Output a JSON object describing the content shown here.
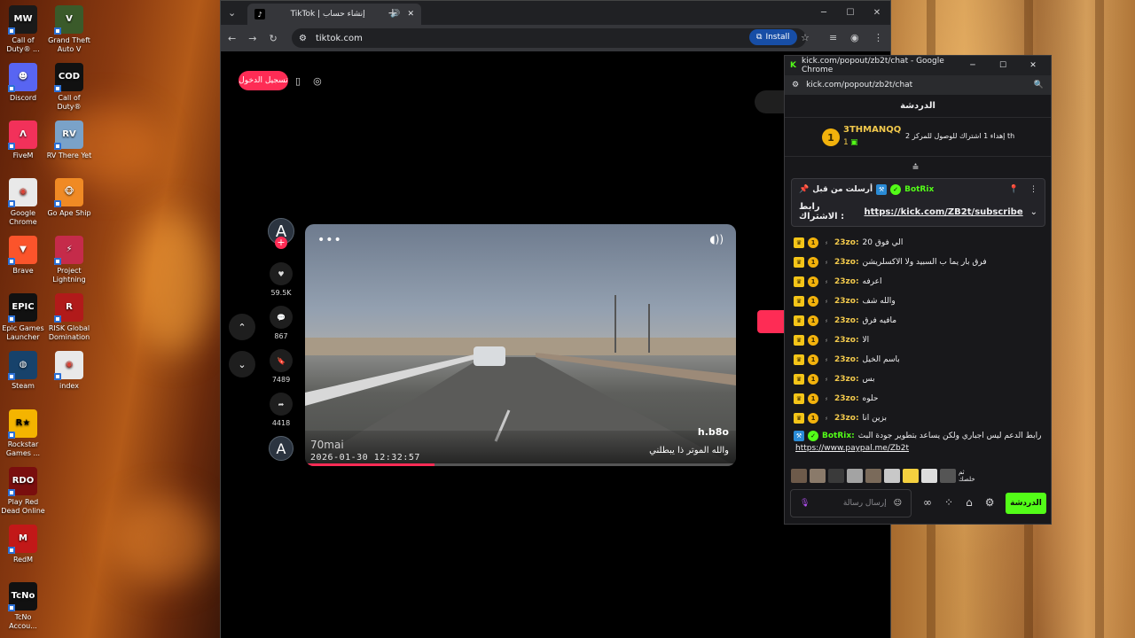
{
  "desktop": {
    "icons": [
      {
        "label": "Call of Duty® ...",
        "glyph": "MW",
        "color": "#1a1a1a",
        "fg": "#ffffff"
      },
      {
        "label": "Grand Theft Auto V",
        "glyph": "V",
        "color": "#3a5a2a",
        "fg": "#ffffff"
      },
      {
        "label": "Discord",
        "glyph": "☻",
        "color": "#5865f2",
        "fg": "#ffffff"
      },
      {
        "label": "Call of Duty®",
        "glyph": "COD",
        "color": "#111111",
        "fg": "#ffffff"
      },
      {
        "label": "FiveM",
        "glyph": "Λ",
        "color": "#f2315a",
        "fg": "#ffffff"
      },
      {
        "label": "RV There Yet",
        "glyph": "RV",
        "color": "#7aa2c8",
        "fg": "#ffffff"
      },
      {
        "label": "Google Chrome",
        "glyph": "◉",
        "color": "#e9e9e9",
        "fg": "#db4437"
      },
      {
        "label": "Go Ape Ship",
        "glyph": "🐵",
        "color": "#f08a24",
        "fg": "#ffffff"
      },
      {
        "label": "Brave",
        "glyph": "▼",
        "color": "#fb542b",
        "fg": "#ffffff"
      },
      {
        "label": "Project Lightning",
        "glyph": "⚡",
        "color": "#c52b4a",
        "fg": "#ffffff"
      },
      {
        "label": "Epic Games Launcher",
        "glyph": "EPIC",
        "color": "#111111",
        "fg": "#ffffff"
      },
      {
        "label": "RISK Global Domination",
        "glyph": "R",
        "color": "#b11a1a",
        "fg": "#ffffff"
      },
      {
        "label": "Steam",
        "glyph": "◍",
        "color": "#17426b",
        "fg": "#ffffff"
      },
      {
        "label": "index",
        "glyph": "◉",
        "color": "#e9e9e9",
        "fg": "#db4437"
      },
      {
        "label": "Rockstar Games ...",
        "glyph": "R★",
        "color": "#f4b400",
        "fg": "#000000"
      },
      {
        "label": "Play Red Dead Online",
        "glyph": "RDO",
        "color": "#7a0e0e",
        "fg": "#ffffff"
      },
      {
        "label": "RedM",
        "glyph": "M",
        "color": "#c21818",
        "fg": "#ffffff"
      },
      {
        "label": "TcNo Accou...",
        "glyph": "TcNo",
        "color": "#111111",
        "fg": "#ffffff"
      }
    ]
  },
  "browser": {
    "tab_title": "TikTok | إنشاء حساب",
    "tab_favicon": "♪",
    "url": "tiktok.com",
    "install_label": "Install",
    "accent": "#fe2c55"
  },
  "tiktok": {
    "login_label": "تسجيل الدخول",
    "avatar_letter": "A",
    "likes": "59.5K",
    "comments": "867",
    "saves": "7489",
    "shares": "4418",
    "author": "h.b8o",
    "caption": "والله الموتر ذا يبطلني",
    "watermark": "70mai",
    "timestamp": "2026-01-30 12:32:57",
    "progress_pct": 30
  },
  "kick": {
    "window_title": "kick.com/popout/zb2t/chat - Google Chrome",
    "url": "kick.com/popout/zb2t/chat",
    "header": "الدردشة",
    "goal_user": "3THMANQQ",
    "goal_count": "1",
    "goal_text": "إهداء 1 اشتراك للوصول للمركز 2 th",
    "pinned_from": "أرسلت من قبل",
    "pinned_author": "BotRix",
    "pinned_label": "رابط الاشتراك :",
    "pinned_link": "https://kick.com/ZB2t/subscribe",
    "messages": [
      {
        "user": "23zo:",
        "text": "الي فوق 20"
      },
      {
        "user": "23zo:",
        "text": "فرق بار يما ب السبيد ولا الاكسلريشن"
      },
      {
        "user": "23zo:",
        "text": "اعرفه"
      },
      {
        "user": "23zo:",
        "text": "والله شف"
      },
      {
        "user": "23zo:",
        "text": "مافيه فرق"
      },
      {
        "user": "23zo:",
        "text": "الا"
      },
      {
        "user": "23zo:",
        "text": "باسم الخيل"
      },
      {
        "user": "23zo:",
        "text": "بس"
      },
      {
        "user": "23zo:",
        "text": "حلوه"
      },
      {
        "user": "23zo:",
        "text": "بزين انا"
      }
    ],
    "bot_user": "BotRix:",
    "bot_text": "رابط الدعم ليس اجباري ولكن يساعد بتطوير جودة البث",
    "bot_link": "https://www.paypal.me/Zb2t",
    "emote_label": "ثم خلصك",
    "input_placeholder": "إرسال رسالة",
    "send_label": "الدردشة",
    "accent": "#53fc18"
  }
}
